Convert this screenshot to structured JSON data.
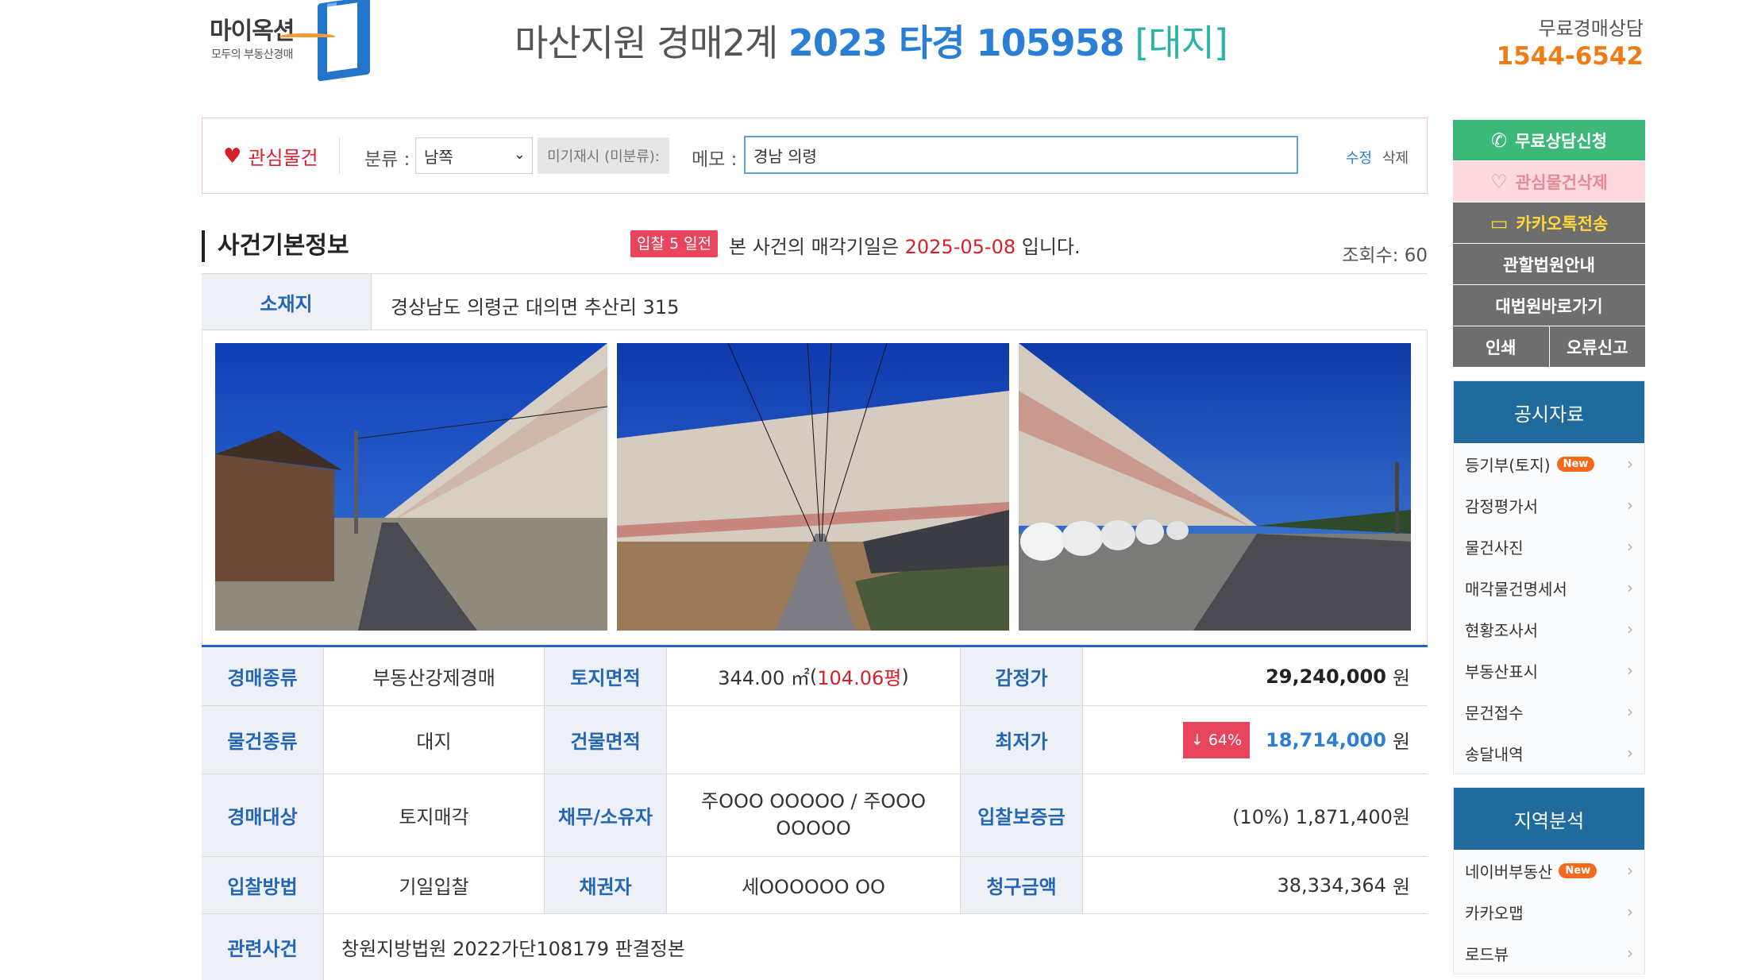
{
  "header": {
    "logo_text": "마이옥션",
    "logo_sub": "모두의 부동산경매",
    "court": "마산지원 경매2계",
    "case_no": "2023 타경 105958",
    "kind": "[대지]",
    "consult_label": "무료경매상담",
    "consult_phone": "1544-6542"
  },
  "interest": {
    "heart_label": "관심물건",
    "category_label": "분류 :",
    "category_value": "남쪽",
    "unassigned_label": "미기재시 (미분류):",
    "memo_label": "메모 :",
    "memo_value": "경남 의령",
    "edit_label": "수정",
    "delete_label": "삭제"
  },
  "case_info": {
    "section_title": "사건기본정보",
    "dday_badge": "입찰 5 일전",
    "sale_prefix": "본 사건의 매각기일은",
    "sale_date": "2025-05-08",
    "sale_suffix": "입니다.",
    "views_label": "조회수: 60",
    "location_label": "소재지",
    "location_value": "경상남도 의령군 대의면 추산리 315"
  },
  "table": {
    "r1": {
      "l1": "경매종류",
      "v1": "부동산강제경매",
      "l2": "토지면적",
      "v2_m2": "344.00 ㎡",
      "v2_py_open": " (",
      "v2_py": "104.06평",
      "v2_py_close": ")",
      "l3": "감정가",
      "v3": "29,240,000",
      "won": "원"
    },
    "r2": {
      "l1": "물건종류",
      "v1": "대지",
      "l2": "건물면적",
      "v2": "",
      "l3": "최저가",
      "rate": "↓ 64%",
      "v3": "18,714,000",
      "won": "원"
    },
    "r3": {
      "l1": "경매대상",
      "v1": "토지매각",
      "l2": "채무/소유자",
      "v2": "주OOO OOOOO / 주OOO OOOOO",
      "l3": "입찰보증금",
      "v3": "(10%) 1,871,400원"
    },
    "r4": {
      "l1": "입찰방법",
      "v1": "기일입찰",
      "l2": "채권자",
      "v2": "세OOOOOO OO",
      "l3": "청구금액",
      "v3": "38,334,364",
      "won": "원"
    },
    "r5": {
      "l1": "관련사건",
      "v1": "창원지방법원 2022가단108179 판결정본"
    }
  },
  "sidebar": {
    "consult_btn": "무료상담신청",
    "unlike_btn": "관심물건삭제",
    "kakao_btn": "카카오톡전송",
    "court_btn": "관할법원안내",
    "supreme_btn": "대법원바로가기",
    "print_btn": "인쇄",
    "report_btn": "오류신고",
    "public_head": "공시자료",
    "public_items": [
      "등기부(토지)",
      "감정평가서",
      "물건사진",
      "매각물건명세서",
      "현황조사서",
      "부동산표시",
      "문건접수",
      "송달내역"
    ],
    "region_head": "지역분석",
    "region_items": [
      "네이버부동산",
      "카카오맵",
      "로드뷰"
    ],
    "new_badge": "New"
  },
  "colors": {
    "accent_blue": "#2a7fd4",
    "label_blue": "#2466b6",
    "red": "#d6202c",
    "orange": "#ef7d17",
    "sidebar_head": "#1f6b9d",
    "green_button": "#3cb878"
  },
  "icons": {
    "heart": "heart-icon",
    "phone": "phone-icon",
    "chat": "chat-bubble-icon",
    "chevron": "chevron-right-icon"
  }
}
